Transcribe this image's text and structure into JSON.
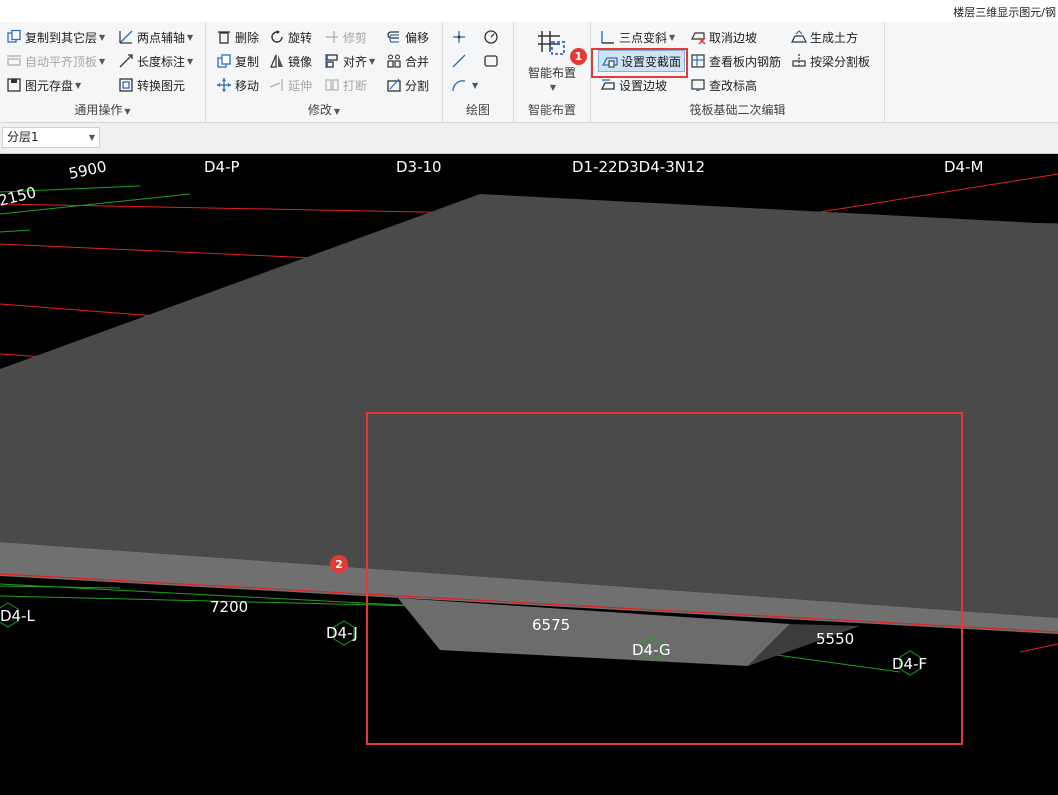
{
  "window": {
    "title": "楼层三维显示图元/钢"
  },
  "ribbon": {
    "general_ops": {
      "label": "通用操作",
      "copy_to_other_layer": "复制到其它层",
      "auto_align_top": "自动平齐顶板",
      "element_save": "图元存盘",
      "two_point_axis": "两点辅轴",
      "length_dimension": "长度标注",
      "convert_element": "转换图元"
    },
    "modify": {
      "label": "修改",
      "delete": "删除",
      "rotate": "旋转",
      "trim": "修剪",
      "offset": "偏移",
      "copy": "复制",
      "mirror": "镜像",
      "align": "对齐",
      "merge": "合并",
      "move": "移动",
      "extend": "延伸",
      "break": "打断",
      "split": "分割"
    },
    "draw": {
      "label": "绘图"
    },
    "smart_layout": {
      "label": "智能布置",
      "button": "智能布置"
    },
    "raft_edit": {
      "label": "筏板基础二次编辑",
      "three_point_slope": "三点变斜",
      "set_variable_section": "设置变截面",
      "set_edge_slope": "设置边坡",
      "cancel_edge_slope": "取消边坡",
      "view_slab_rebar": "查看板内钢筋",
      "modify_elevation": "查改标高",
      "generate_earthwork": "生成土方",
      "split_by_beam": "按梁分割板"
    }
  },
  "layer": {
    "current": "分层1"
  },
  "annotations": {
    "badge1": "1",
    "badge2": "2"
  },
  "viewport": {
    "axis_labels": {
      "d4p": "D4-P",
      "d310": "D3-10",
      "d122": "D1-22D3D4-3N12",
      "d4m": "D4-M",
      "d4l": "D4-L",
      "d4j": "D4-J",
      "d4g": "D4-G",
      "d4f": "D4-F"
    },
    "dimensions": {
      "d5900": "5900",
      "d2150": "2150",
      "d7200": "7200",
      "d6575": "6575",
      "d5550": "5550"
    }
  },
  "colors": {
    "slab_top": "#4a4a4a",
    "slab_edge": "#6f6f6f",
    "red_line": "#e02020",
    "green_line": "#1ea01e",
    "highlight": "#e53935"
  }
}
